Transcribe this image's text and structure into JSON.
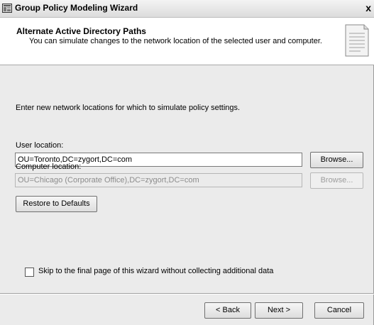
{
  "window": {
    "title": "Group Policy Modeling Wizard",
    "close_glyph": "x"
  },
  "header": {
    "title": "Alternate Active Directory Paths",
    "subtitle": "You can simulate changes to the network location of the selected user and computer."
  },
  "intro_text": "Enter new network locations for which to simulate policy settings.",
  "user_location": {
    "label": "User location:",
    "value": "OU=Toronto,DC=zygort,DC=com",
    "browse_label": "Browse..."
  },
  "computer_location": {
    "label": "Computer location:",
    "value": "OU=Chicago (Corporate Office),DC=zygort,DC=com",
    "browse_label": "Browse..."
  },
  "restore_button_label": "Restore to Defaults",
  "skip_checkbox": {
    "label": "Skip to the final page of this wizard without collecting additional data",
    "checked": false
  },
  "footer": {
    "back_label": "< Back",
    "next_label": "Next >",
    "cancel_label": "Cancel"
  },
  "icons": [
    "gpo-wizard-icon",
    "close-icon",
    "document-icon"
  ]
}
